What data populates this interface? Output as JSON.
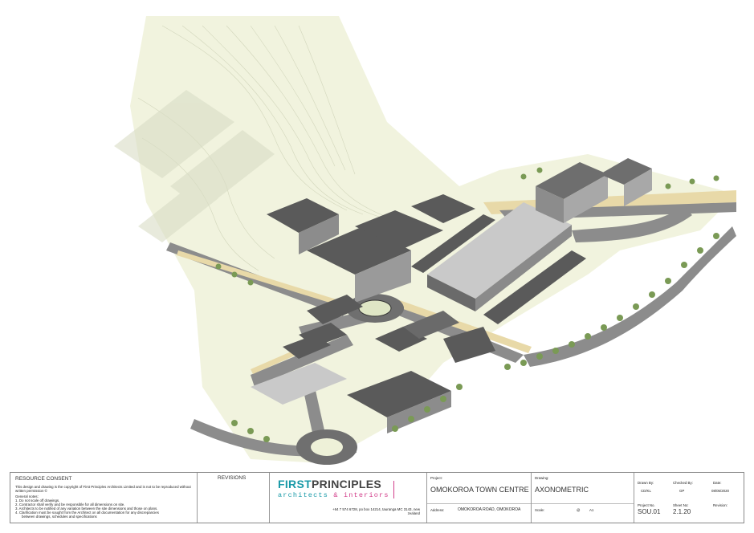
{
  "title_block": {
    "section_title": "RESOURCE CONSENT",
    "copyright": "This design and drawing is the copyright of First Principles Architects Limited and is not to be reproduced without written permission ©",
    "notes_heading": "General notes:",
    "notes": [
      "1. Do not scale off drawings.",
      "2. Contractor shall verify and be responsible for all dimensions on site.",
      "3. Architects to be notified of any variation between the site dimensions and those on plans.",
      "4. Clarification must be sought from the Architect on all documentation for any discrepancies",
      "between drawings, schedules and specifications"
    ],
    "revisions_label": "REVISIONS",
    "brand_first": "FIRST",
    "brand_principles": "PRINCIPLES",
    "brand_architects": "architects",
    "brand_amp": "&",
    "brand_interiors": "interiors",
    "contact_line1": "+64 7 574 6728, po box 14214, tauranga MC 3143, new",
    "contact_line2": "zealand",
    "project_label": "Project:",
    "project_value": "OMOKOROA TOWN CENTRE",
    "address_label": "Address:",
    "address_value": "OMOKOROA ROAD, OMOKOROA",
    "drawing_label": "Drawing:",
    "drawing_value": "AXONOMETRIC",
    "scale_label": "Scale:",
    "scale_at": "@",
    "scale_value": "A1",
    "drawn_by_label": "Drawn By:",
    "drawn_by_value": "CD/KL",
    "checked_by_label": "Checked By:",
    "checked_by_value": "GP",
    "date_label": "Date:",
    "date_value": "08/05/2020",
    "project_no_label": "Project No.",
    "project_no_value": "SOU.01",
    "sheet_no_label": "Sheet No:",
    "sheet_no_value": "2.1.20",
    "revision_label": "Revision:",
    "revision_value": ""
  },
  "colors": {
    "terrain": "#eef1d8",
    "road": "#8c8c8c",
    "road_dark": "#6f6f6f",
    "footpath": "#e8d9a8",
    "roof": "#5a5a5a",
    "roof_light": "#c9c9c9",
    "tree": "#7a9a55",
    "brand_teal": "#1a9aa8",
    "brand_magenta": "#d23d8a"
  }
}
